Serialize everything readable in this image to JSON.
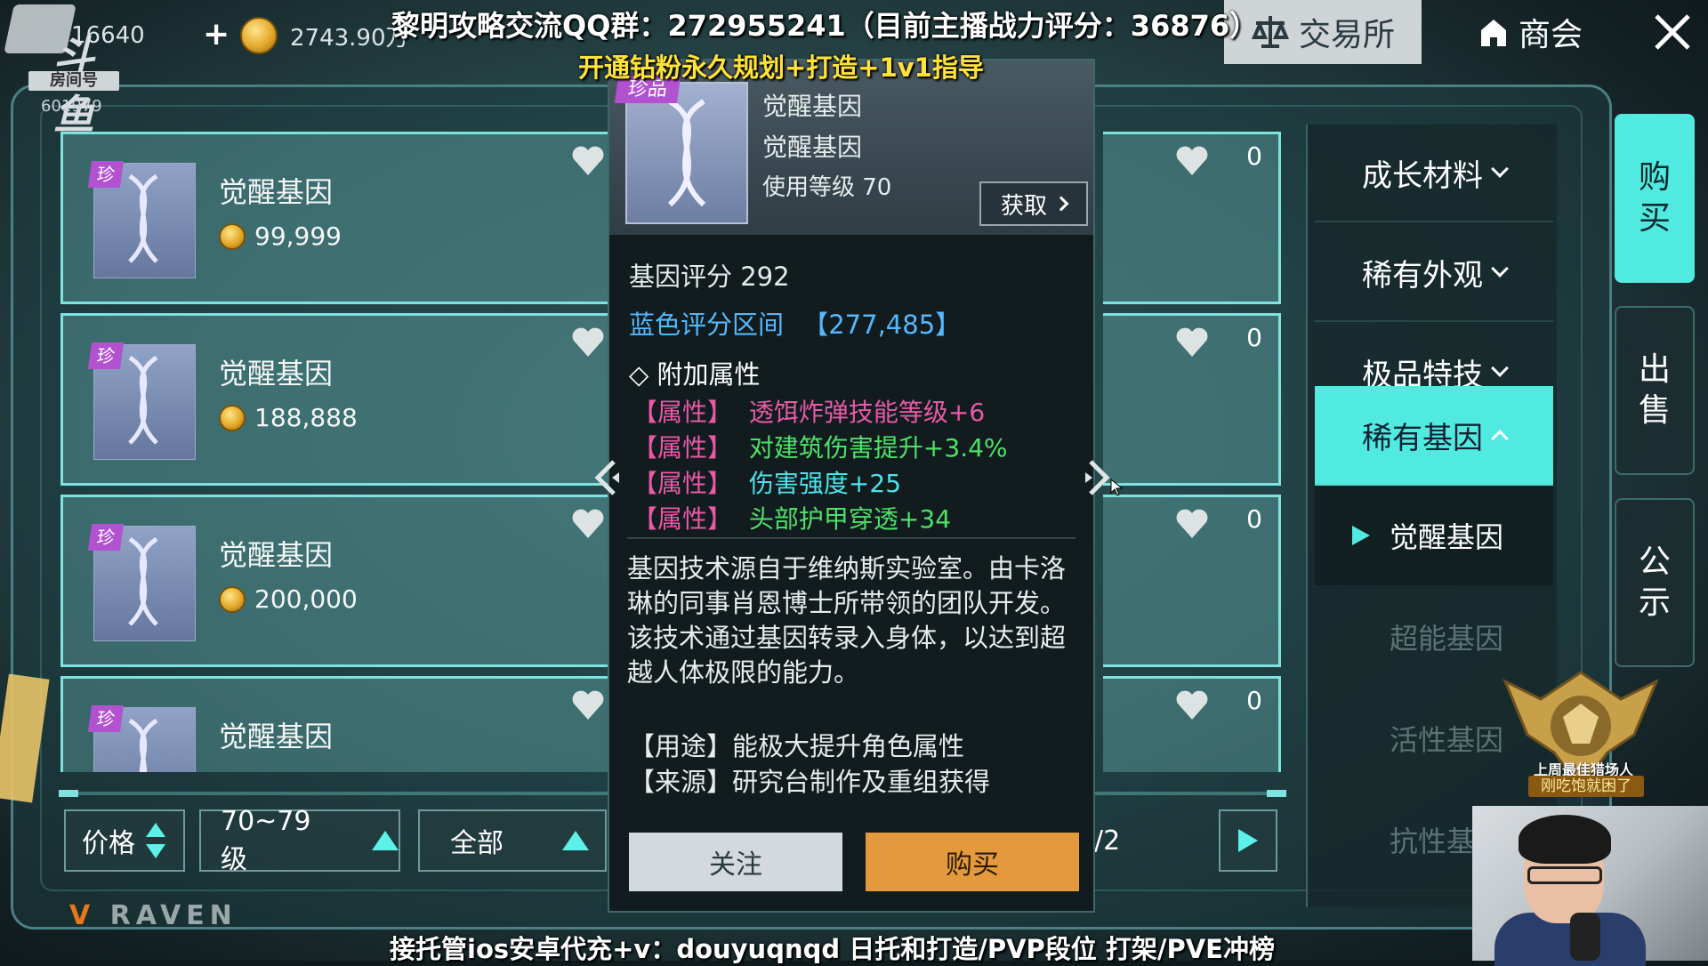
{
  "topbar": {
    "logo_text": "斗鱼",
    "room_label": "房间号",
    "room_number": "601979",
    "resource1_value": "16640",
    "resource2_value": "2743.90万",
    "exchange_label": "交易所",
    "guild_label": "商会"
  },
  "overlay": {
    "line1": "黎明攻略交流QQ群：272955241（目前主播战力评分：36876）",
    "line2": "开通钻粉永久规划+打造+1v1指导",
    "line3": "接托管ios安卓代充+v：douyuqnqd 日托和打造/PVP段位 打架/PVE冲榜",
    "badge_line1": "上周最佳猎场人",
    "badge_line2": "刚吃饱就困了"
  },
  "listings": [
    {
      "tag": "珍",
      "name": "觉醒基因",
      "price": "99,999",
      "likes": "0"
    },
    {
      "tag": "珍",
      "name": "觉醒基因",
      "price": "188,888",
      "likes": "0"
    },
    {
      "tag": "珍",
      "name": "觉醒基因",
      "price": "200,000",
      "likes": "0"
    },
    {
      "tag": "珍",
      "name": "觉醒基因",
      "price": "",
      "likes": "0"
    }
  ],
  "filters": {
    "sort_label": "价格",
    "level_label": "70~79级",
    "quality_label": "全部",
    "page_text": "/2",
    "brand": "RAVEN"
  },
  "categories": [
    {
      "label": "成长材料",
      "expanded": false
    },
    {
      "label": "稀有外观",
      "expanded": false
    },
    {
      "label": "极品特技",
      "expanded": false
    },
    {
      "label": "稀有基因",
      "expanded": true
    }
  ],
  "subcategories": [
    {
      "label": "觉醒基因",
      "active": true
    },
    {
      "label": "超能基因",
      "active": false
    },
    {
      "label": "活性基因",
      "active": false
    },
    {
      "label": "抗性基因",
      "active": false
    }
  ],
  "side_tabs": {
    "buy": "购买",
    "sell": "出售",
    "notice": "公示"
  },
  "popup": {
    "rarity_tag": "珍品",
    "title": "觉醒基因",
    "subtitle": "觉醒基因",
    "use_level": "使用等级 70",
    "get_label": "获取",
    "gene_score": "基因评分 292",
    "blue_range_label": "蓝色评分区间",
    "blue_range_value": "【277,485】",
    "extra_attrs_label": "◇ 附加属性",
    "attributes": [
      {
        "key": "【属性】",
        "value": "透饵炸弹技能等级+6",
        "color": "#e65aa8"
      },
      {
        "key": "【属性】",
        "value": "对建筑伤害提升+3.4%",
        "color": "#4fe06a"
      },
      {
        "key": "【属性】",
        "value": "伤害强度+25",
        "color": "#4ee3ea"
      },
      {
        "key": "【属性】",
        "value": "头部护甲穿透+34",
        "color": "#4fe06a"
      }
    ],
    "description": "基因技术源自于维纳斯实验室。由卡洛琳的同事肖恩博士所带领的团队开发。该技术通过基因转录入身体，以达到超越人体极限的能力。",
    "usage": "【用途】能极大提升角色属性",
    "source": "【来源】研究台制作及重组获得",
    "follow_label": "关注",
    "buy_label": "购买"
  },
  "colors": {
    "accent_cyan": "#50eae1",
    "rarity_purple": "#b252d0",
    "buy_orange": "#e49a3c",
    "overlay_yellow": "#ffe23a"
  }
}
